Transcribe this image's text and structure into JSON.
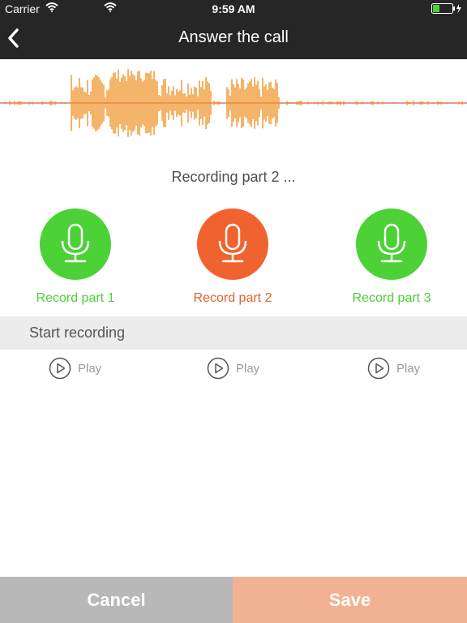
{
  "status_bar": {
    "carrier": "Carrier",
    "time": "9:59 AM",
    "battery_icon": "battery-icon",
    "wifi_icon": "wifi-icon"
  },
  "nav": {
    "title": "Answer the call",
    "back_icon": "chevron-left-icon"
  },
  "recording_status": "Recording part 2 ...",
  "record_buttons": [
    {
      "label": "Record part 1",
      "color": "#4cd137",
      "icon": "microphone-icon"
    },
    {
      "label": "Record part 2",
      "color": "#f0632f",
      "icon": "microphone-icon"
    },
    {
      "label": "Record part 3",
      "color": "#4cd137",
      "icon": "microphone-icon"
    }
  ],
  "start_recording": "Start recording",
  "play_buttons": [
    {
      "label": "Play",
      "icon": "play-circle-icon"
    },
    {
      "label": "Play",
      "icon": "play-circle-icon"
    },
    {
      "label": "Play",
      "icon": "play-circle-icon"
    }
  ],
  "footer": {
    "cancel_label": "Cancel",
    "save_label": "Save"
  },
  "colors": {
    "header_bg": "#262626",
    "waveform": "#f0942a",
    "waveform_line": "#c0392b",
    "green": "#4cd137",
    "orange": "#f0632f",
    "cancel_bg": "#b8b8b8",
    "save_bg": "#f3b194"
  }
}
